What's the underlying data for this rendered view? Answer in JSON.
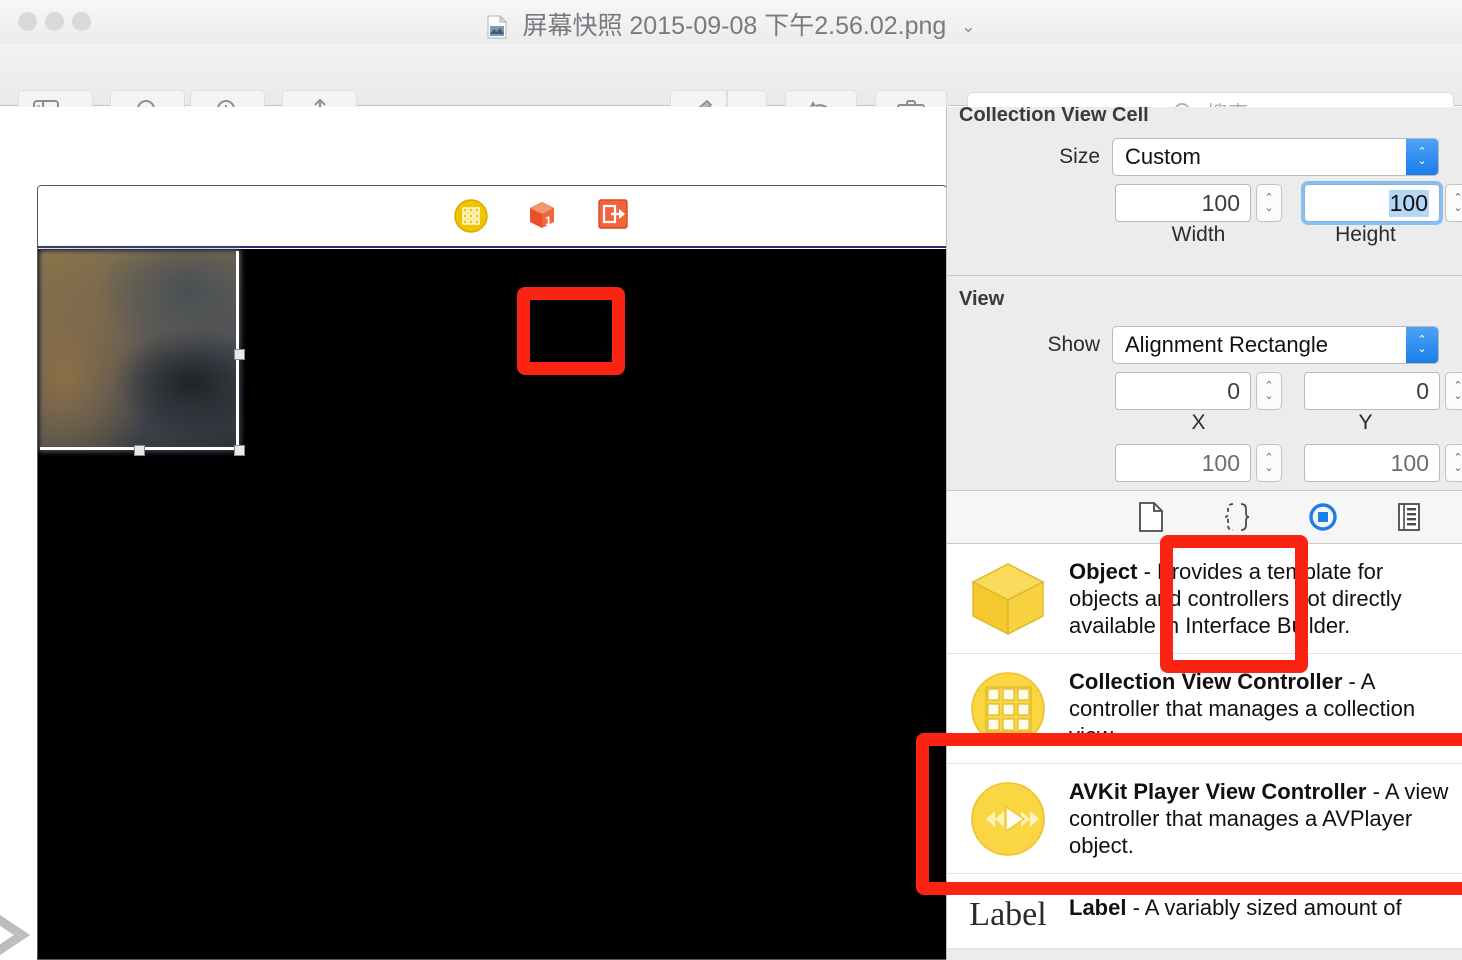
{
  "window": {
    "title": "屏幕快照 2015-09-08 下午2.56.02.png",
    "title_icon": "image-file-icon",
    "title_chevron": "chevron-down-icon",
    "traffic_lights": [
      "close-button",
      "minimize-button",
      "zoom-button"
    ]
  },
  "toolbar": {
    "sidebar_label": "sidebar-view-icon",
    "sidebar_caret": "chevron-down-icon",
    "zoom_out": "zoom-out-icon",
    "zoom_in": "zoom-in-icon",
    "share": "share-icon",
    "markup": "markup-pen-icon",
    "markup_caret": "chevron-down-icon",
    "rotate": "rotate-left-icon",
    "toolbox": "markup-toolbox-icon"
  },
  "search": {
    "placeholder": "搜索",
    "value": "",
    "icon": "search-icon"
  },
  "canvas": {
    "scene_dock_icons": [
      "collection-view-controller-icon",
      "first-responder-cube-icon",
      "exit-segue-icon"
    ],
    "page_nav": "chevron-right-icon"
  },
  "inspector": {
    "cell_section": {
      "title": "Collection View Cell",
      "size_label": "Size",
      "size_value": "Custom",
      "width_value": "100",
      "width_label": "Width",
      "height_value": "100",
      "height_label": "Height"
    },
    "view_section": {
      "title": "View",
      "show_label": "Show",
      "show_value": "Alignment Rectangle",
      "x_value": "0",
      "x_label": "X",
      "y_value": "0",
      "y_label": "Y",
      "w_value": "100",
      "h_value": "100"
    }
  },
  "library": {
    "tabs": [
      {
        "name": "file-template-library-icon",
        "selected": false
      },
      {
        "name": "code-snippet-library-icon",
        "selected": false
      },
      {
        "name": "object-library-icon",
        "selected": true
      },
      {
        "name": "media-library-icon",
        "selected": false
      }
    ],
    "items": [
      {
        "icon": "object-cube-icon",
        "title": "Object",
        "desc": " - Provides a template for objects and controllers not directly available in Interface Builder.",
        "highlighted": false
      },
      {
        "icon": "collection-view-controller-icon",
        "title": "Collection View Controller",
        "desc": " - A controller that manages a collection view.",
        "highlighted": true
      },
      {
        "icon": "avkit-player-icon",
        "title": "AVKit Player View Controller",
        "desc": " - A view controller that manages a AVPlayer object.",
        "highlighted": false
      },
      {
        "icon": "label-icon",
        "title": "Label",
        "desc": " - A variably sized amount of",
        "highlighted": false
      }
    ]
  },
  "annotations": {
    "accent_color": "#fb2412",
    "boxes": [
      "scene-dock-collection-view-icon-highlight",
      "view-size-xy-highlight",
      "collection-view-controller-library-item-highlight"
    ]
  },
  "colors": {
    "red_annotation": "#fb2412",
    "yellow_icon": "#f7ce3c",
    "orange_icon": "#f1643c",
    "blue_accent": "#1a7ee8",
    "canvas_black": "#000000"
  }
}
